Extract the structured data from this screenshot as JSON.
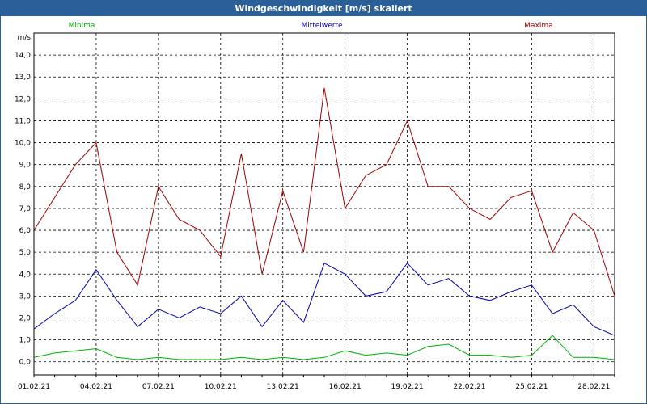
{
  "window": {
    "title": "Windgeschwindigkeit [m/s] skaliert"
  },
  "chart_data": {
    "type": "line",
    "title": "Windgeschwindigkeit [m/s] skaliert",
    "ylabel": "m/s",
    "xlabel": "",
    "ylim": [
      -0.6,
      15.0
    ],
    "xlim": [
      "01.02.21 00:00",
      "01.03.21 00:00"
    ],
    "grid": true,
    "legend_position": "top",
    "y_ticks": [
      "0,0",
      "1,0",
      "2,0",
      "3,0",
      "4,0",
      "5,0",
      "6,0",
      "7,0",
      "8,0",
      "9,0",
      "10,0",
      "11,0",
      "12,0",
      "13,0",
      "14,0"
    ],
    "x_ticks": [
      "01.02.21",
      "04.02.21",
      "07.02.21",
      "10.02.21",
      "13.02.21",
      "16.02.21",
      "19.02.21",
      "22.02.21",
      "25.02.21",
      "28.02.21"
    ],
    "x": [
      "01.02.21",
      "02.02.21",
      "03.02.21",
      "04.02.21",
      "05.02.21",
      "06.02.21",
      "07.02.21",
      "08.02.21",
      "09.02.21",
      "10.02.21",
      "11.02.21",
      "12.02.21",
      "13.02.21",
      "14.02.21",
      "15.02.21",
      "16.02.21",
      "17.02.21",
      "18.02.21",
      "19.02.21",
      "20.02.21",
      "21.02.21",
      "22.02.21",
      "23.02.21",
      "24.02.21",
      "25.02.21",
      "26.02.21",
      "27.02.21",
      "28.02.21",
      "01.03.21"
    ],
    "series": [
      {
        "name": "Minima",
        "color": "#00b000",
        "values": [
          0.2,
          0.4,
          0.5,
          0.6,
          0.2,
          0.1,
          0.2,
          0.1,
          0.1,
          0.1,
          0.2,
          0.1,
          0.2,
          0.1,
          0.2,
          0.5,
          0.3,
          0.4,
          0.3,
          0.7,
          0.8,
          0.3,
          0.3,
          0.2,
          0.3,
          1.2,
          0.2,
          0.2,
          0.1
        ]
      },
      {
        "name": "Mittelwerte",
        "color": "#0000b0",
        "values": [
          1.5,
          2.2,
          2.8,
          4.2,
          2.8,
          1.6,
          2.4,
          2.0,
          2.5,
          2.2,
          3.0,
          1.6,
          2.8,
          1.8,
          4.5,
          4.0,
          3.0,
          3.2,
          4.5,
          3.5,
          3.8,
          3.0,
          2.8,
          3.2,
          3.5,
          2.2,
          2.6,
          1.6,
          1.2
        ]
      },
      {
        "name": "Maxima",
        "color": "#a00000",
        "values": [
          6.0,
          7.5,
          9.0,
          10.0,
          5.0,
          3.5,
          8.0,
          6.5,
          6.0,
          4.8,
          9.5,
          4.0,
          7.8,
          5.0,
          12.5,
          7.0,
          8.5,
          9.0,
          11.0,
          8.0,
          8.0,
          7.0,
          6.5,
          7.5,
          7.8,
          5.0,
          6.8,
          6.0,
          3.0
        ]
      }
    ]
  }
}
